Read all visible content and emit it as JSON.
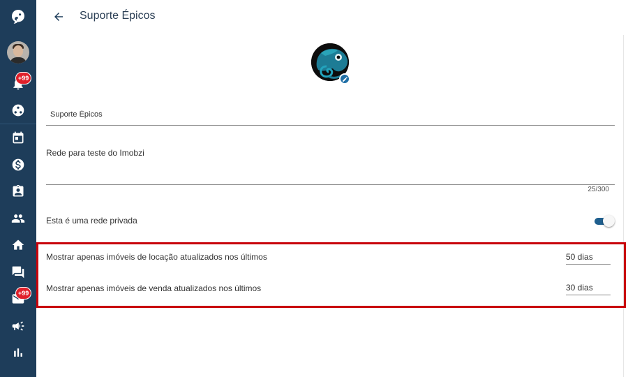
{
  "header": {
    "title": "Suporte Épicos"
  },
  "sidebar": {
    "items": [
      {
        "name": "logo",
        "icon": "chameleon-logo-icon"
      },
      {
        "name": "user-avatar",
        "icon": "avatar"
      },
      {
        "name": "notifications",
        "icon": "bell-icon",
        "badge": "+99"
      },
      {
        "name": "networks",
        "icon": "network-icon"
      },
      {
        "name": "calendar",
        "icon": "calendar-icon"
      },
      {
        "name": "finance",
        "icon": "dollar-icon"
      },
      {
        "name": "contacts",
        "icon": "contact-card-icon"
      },
      {
        "name": "people",
        "icon": "people-icon"
      },
      {
        "name": "properties",
        "icon": "home-icon"
      },
      {
        "name": "chat",
        "icon": "chat-icon"
      },
      {
        "name": "messages",
        "icon": "mail-icon",
        "badge": "+99"
      },
      {
        "name": "marketing",
        "icon": "megaphone-icon"
      },
      {
        "name": "reports",
        "icon": "bar-chart-icon"
      }
    ],
    "colors": {
      "background": "#1e3d5a"
    }
  },
  "form": {
    "name_value": "Suporte Épicos",
    "description_value": "Rede para teste do Imobzi",
    "description_counter": "25/300",
    "private_label": "Esta é uma rede privada",
    "private_enabled": true,
    "rental_filter_label": "Mostrar apenas imóveis de locação atualizados nos últimos",
    "rental_days_value": "50 dias",
    "sale_filter_label": "Mostrar apenas imóveis de venda atualizados nos últimos",
    "sale_days_value": "30 dias"
  },
  "colors": {
    "highlight_border": "#c8000a",
    "toggle_on": "#1f5f8e",
    "badge": "#e0202a"
  }
}
